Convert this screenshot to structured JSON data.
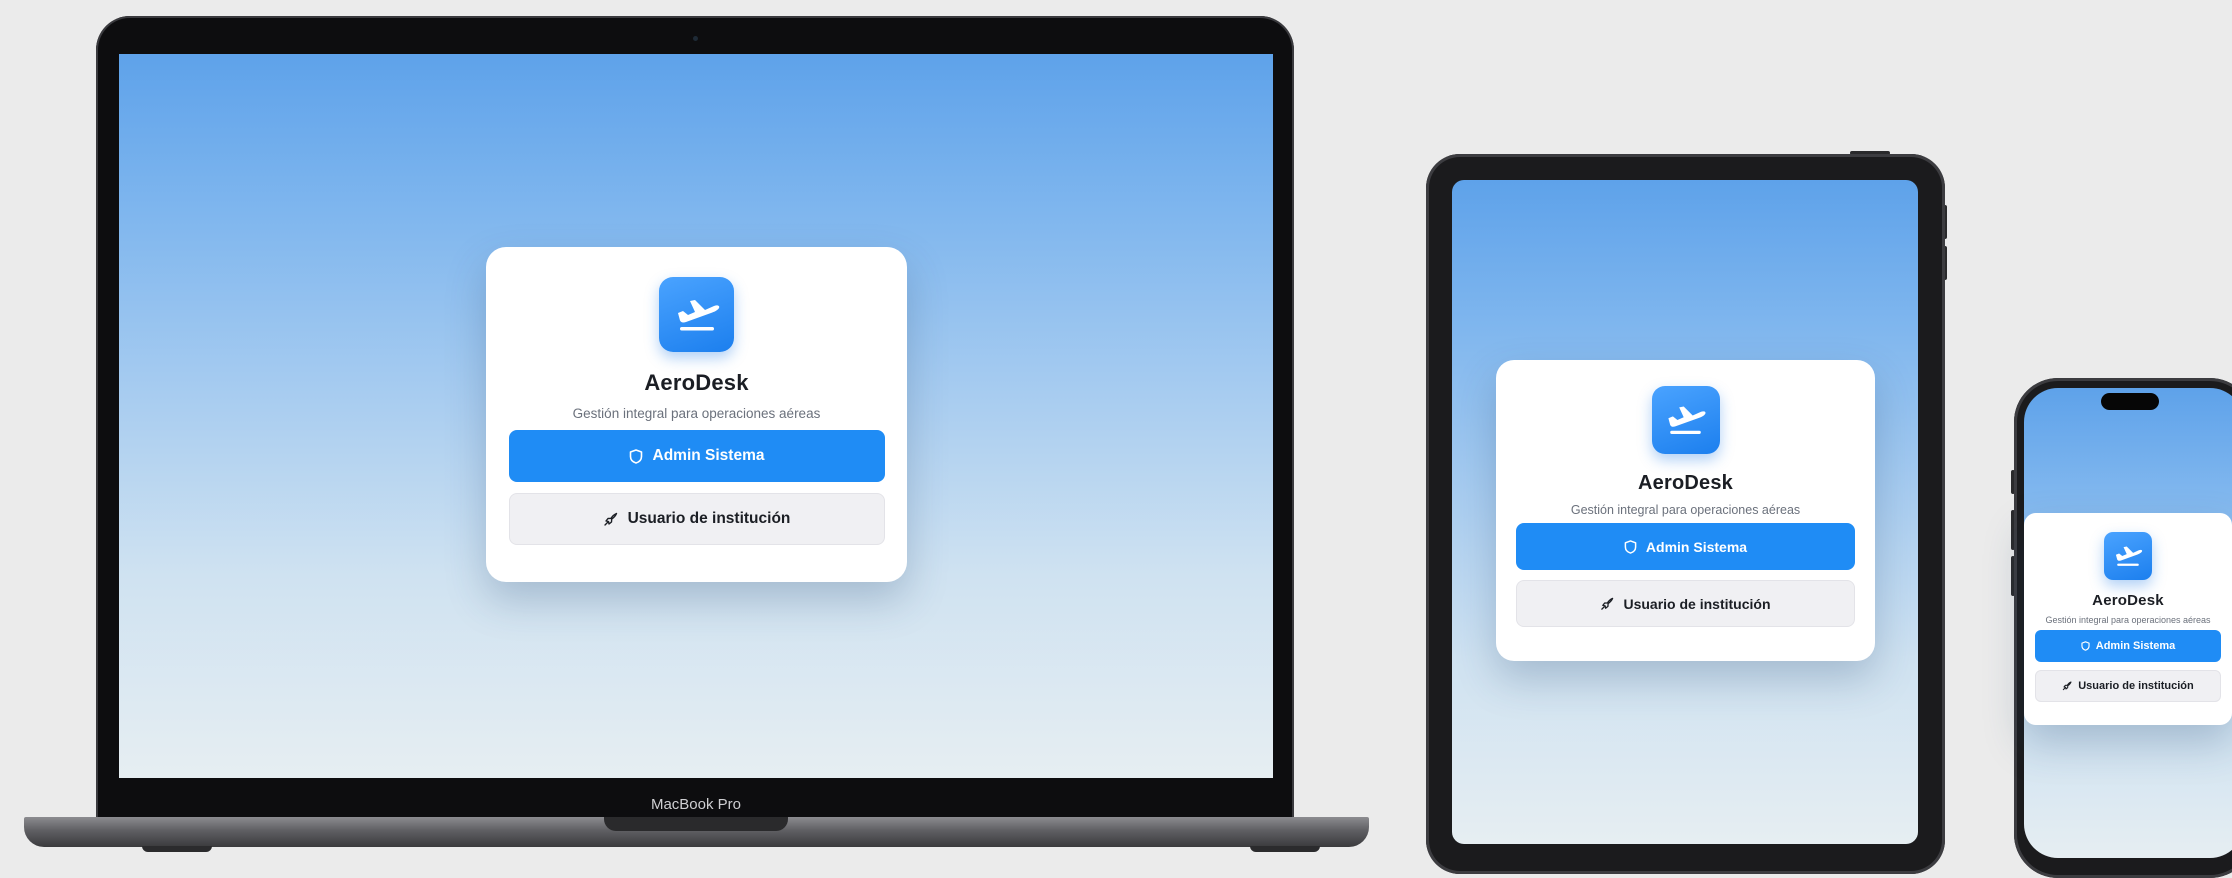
{
  "app": {
    "name": "AeroDesk",
    "tagline": "Gestión integral para operaciones aéreas",
    "logo_icon": "airplane-takeoff-icon",
    "brand_color": "#1f8cf5"
  },
  "buttons": {
    "admin": {
      "label": "Admin Sistema",
      "icon": "shield-icon"
    },
    "institution": {
      "label": "Usuario de institución",
      "icon": "rocket-icon"
    }
  },
  "devices": {
    "laptop_label": "MacBook Pro"
  }
}
